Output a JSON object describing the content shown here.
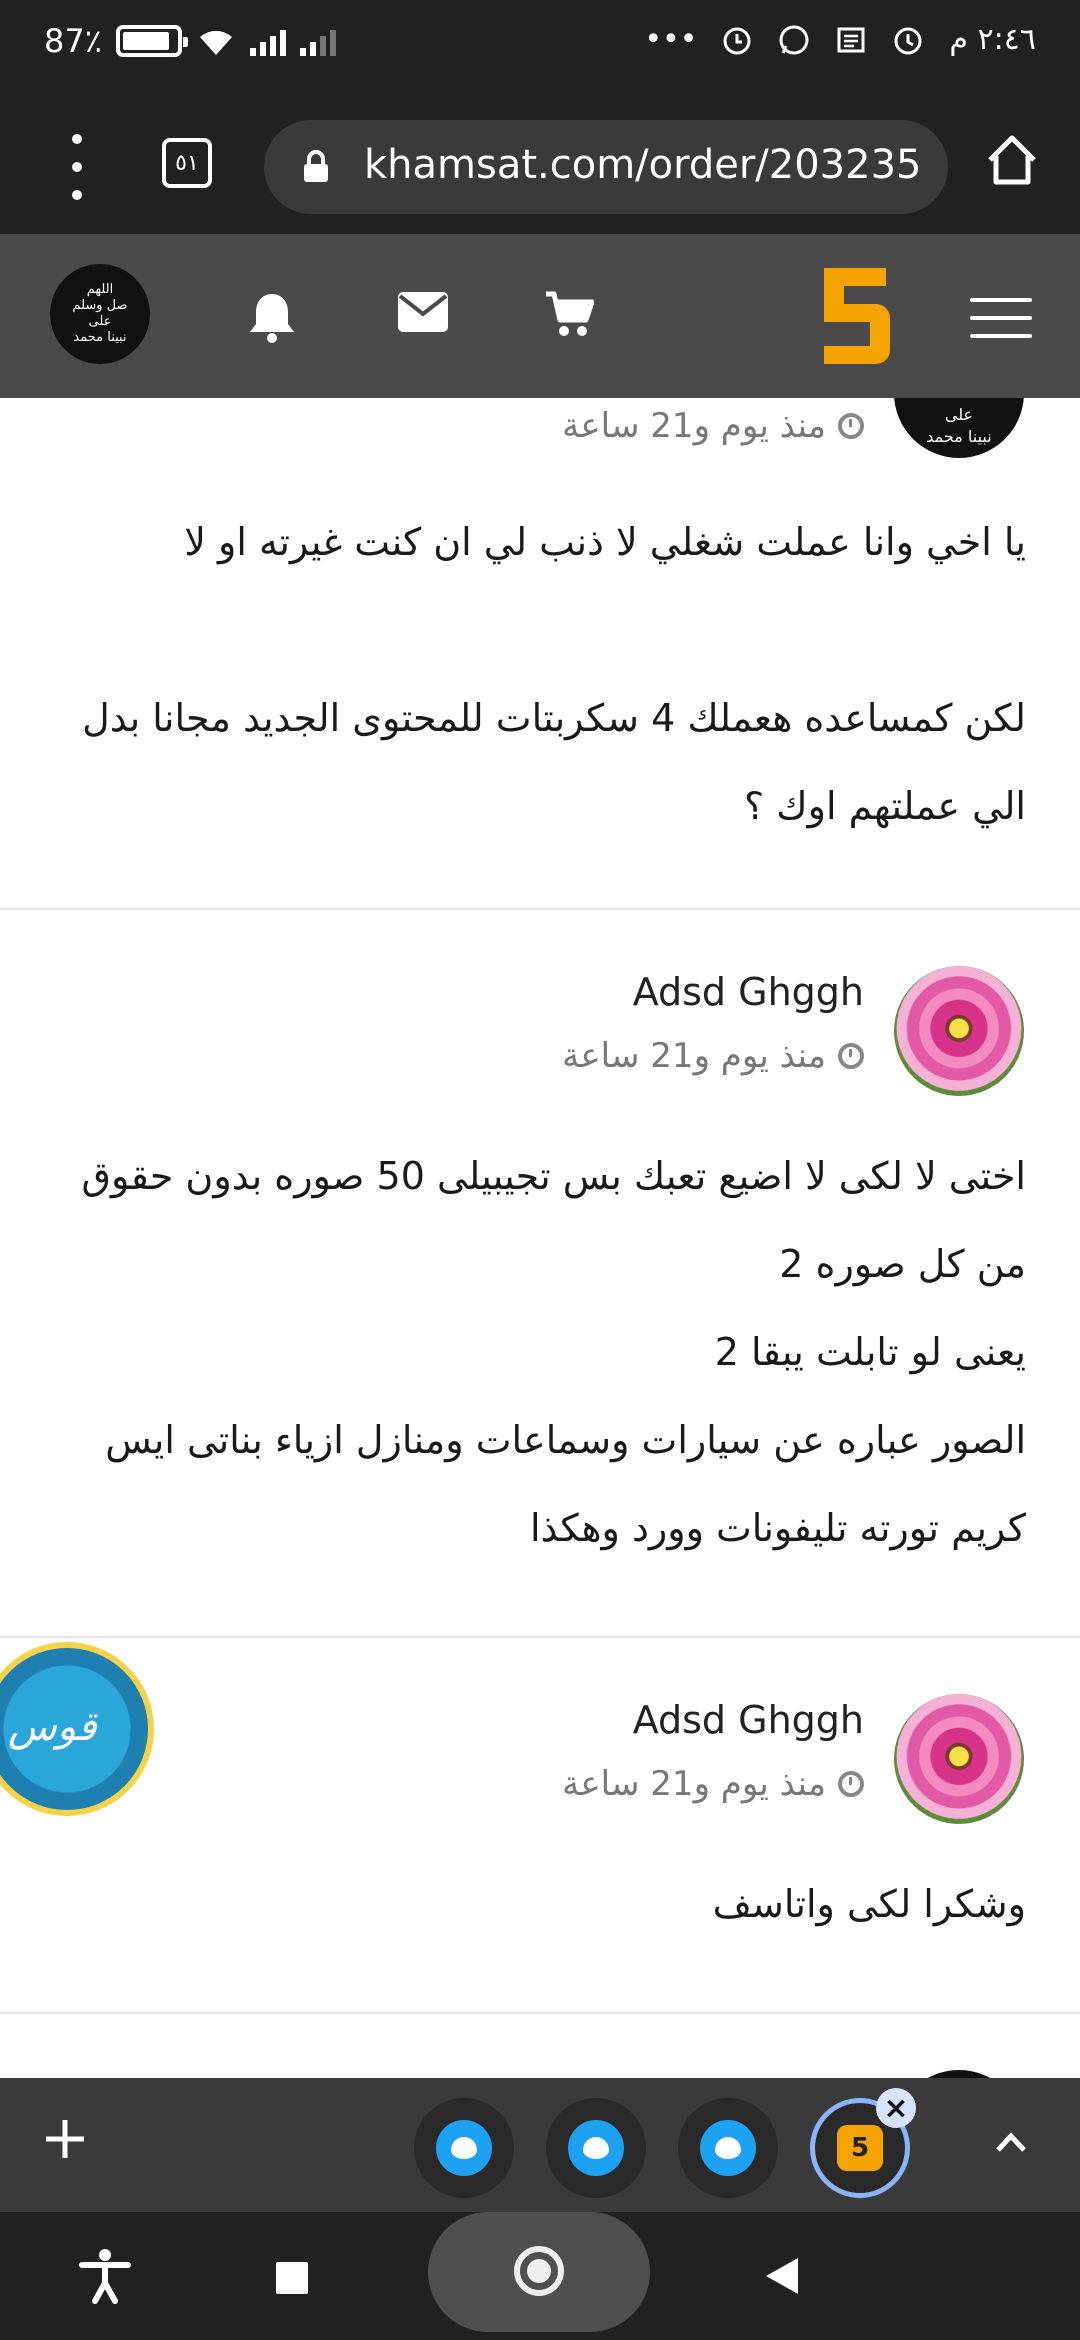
{
  "status_bar": {
    "battery": "87٪",
    "time": "٢:٤٦ م",
    "dots": "•••"
  },
  "browser": {
    "tab_count": "٥١",
    "url": "khamsat.com/order/203235"
  },
  "header": {
    "avatar_lines": [
      "اللهم",
      "صل وسلم",
      "على",
      "نبينا محمد"
    ],
    "logo": "5"
  },
  "comments": [
    {
      "avatar_text": [
        "على",
        "نبينا محمد"
      ],
      "time": "منذ يوم و21 ساعة",
      "lines": [
        "يا اخي وانا عملت شغلي لا ذنب لي ان كنت غيرته او لا",
        "",
        "لكن كمساعده هعملك 4 سكربتات للمحتوى الجديد مجانا بدل",
        "الي عملتهم اوك ؟"
      ]
    },
    {
      "name": "Adsd Ghggh",
      "time": "منذ يوم و21 ساعة",
      "lines": [
        "اختى لا لكى لا اضيع تعبك بس تجيبيلى 50 صوره بدون حقوق",
        "من كل صوره 2",
        "يعنى لو تابلت يبقا 2",
        "الصور عباره عن سيارات وسماعات ومنازل ازياء بناتى ايس",
        "كريم تورته تليفونات وورد وهكذا"
      ]
    },
    {
      "name": "Adsd Ghggh",
      "time": "منذ يوم و21 ساعة",
      "lines": [
        "وشكرا لكى واتاسف"
      ]
    }
  ],
  "floating_chip": {
    "text": "قوس"
  },
  "bottom_tabs": {
    "active_tab_label": "5",
    "close": "×"
  },
  "colors": {
    "brand": "#f4a300",
    "dark": "#212121",
    "header": "#4a4a4a"
  }
}
